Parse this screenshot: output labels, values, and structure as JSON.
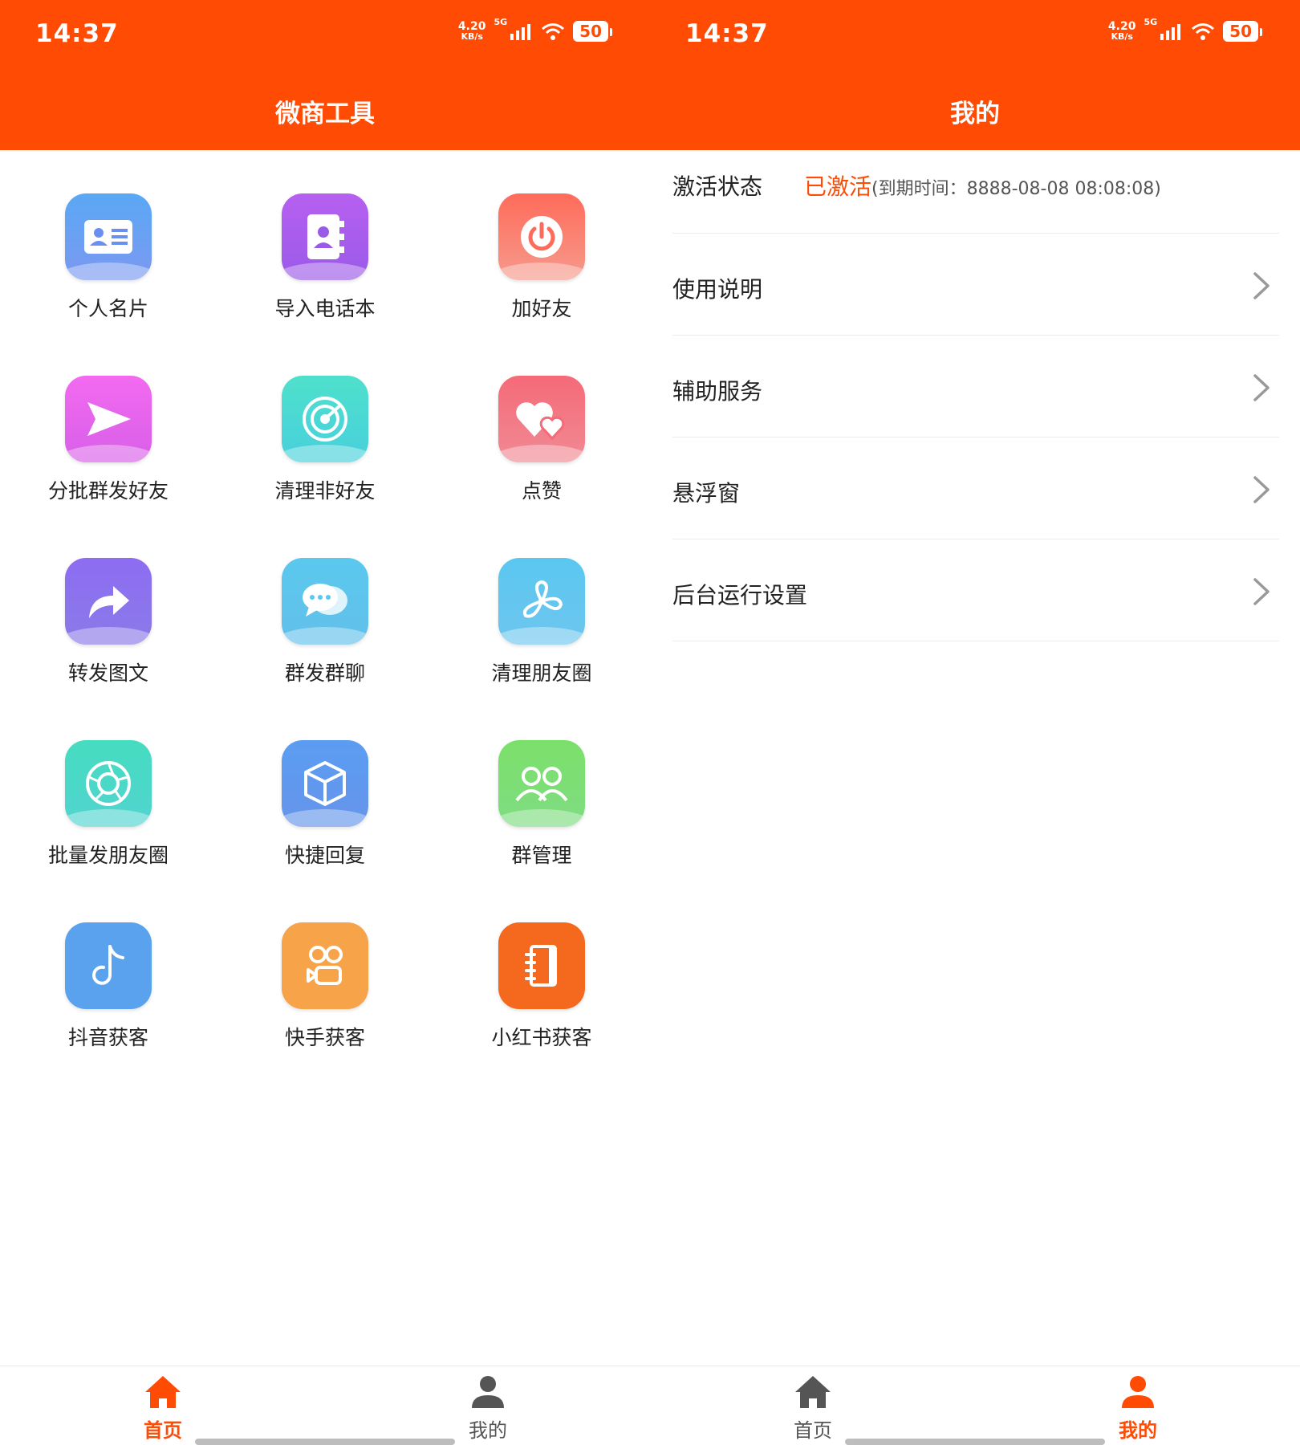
{
  "status": {
    "time": "14:37",
    "speed_value": "4.20",
    "speed_unit": "KB/s",
    "network": "5G",
    "battery": "50"
  },
  "home": {
    "title": "微商工具",
    "tools": [
      {
        "label": "个人名片",
        "icon": "id-card-icon",
        "colors": [
          "#5aa8f5",
          "#6b8ff0"
        ]
      },
      {
        "label": "导入电话本",
        "icon": "contact-book-icon",
        "colors": [
          "#b760f0",
          "#8b56e8"
        ]
      },
      {
        "label": "加好友",
        "icon": "power-icon",
        "colors": [
          "#ff6b5a",
          "#f38a7c"
        ]
      },
      {
        "label": "分批群发好友",
        "icon": "send-icon",
        "colors": [
          "#f26af0",
          "#d24fe6"
        ]
      },
      {
        "label": "清理非好友",
        "icon": "radar-icon",
        "colors": [
          "#4ee0cc",
          "#36c6d8"
        ]
      },
      {
        "label": "点赞",
        "icon": "hearts-icon",
        "colors": [
          "#f56a78",
          "#e9495a"
        ]
      },
      {
        "label": "转发图文",
        "icon": "share-arrow-icon",
        "colors": [
          "#8d6df2",
          "#6a5ae8"
        ]
      },
      {
        "label": "群发群聊",
        "icon": "chat-bubbles-icon",
        "colors": [
          "#5bc8ee",
          "#45b2e8"
        ]
      },
      {
        "label": "清理朋友圈",
        "icon": "pinwheel-icon",
        "colors": [
          "#5ac7f0",
          "#4fb4ec"
        ]
      },
      {
        "label": "批量发朋友圈",
        "icon": "aperture-icon",
        "colors": [
          "#45dcc0",
          "#3cc9c9"
        ]
      },
      {
        "label": "快捷回复",
        "icon": "cube-icon",
        "colors": [
          "#5a9df2",
          "#4d84e8"
        ]
      },
      {
        "label": "群管理",
        "icon": "group-icon",
        "colors": [
          "#7be06a",
          "#55cf5e"
        ]
      },
      {
        "label": "抖音获客",
        "icon": "music-note-icon",
        "colors": [
          "#5aa2ee",
          "#5aa2ee"
        ]
      },
      {
        "label": "快手获客",
        "icon": "video-camera-icon",
        "colors": [
          "#f6a34a",
          "#f6a34a"
        ]
      },
      {
        "label": "小红书获客",
        "icon": "notebook-icon",
        "colors": [
          "#f5691f",
          "#f5691f"
        ]
      }
    ]
  },
  "mine": {
    "title": "我的",
    "activation": {
      "label": "激活状态",
      "status": "已激活",
      "expire": "(到期时间：8888-08-08 08:08:08)"
    },
    "menu": [
      {
        "label": "使用说明"
      },
      {
        "label": "辅助服务"
      },
      {
        "label": "悬浮窗"
      },
      {
        "label": "后台运行设置"
      }
    ]
  },
  "nav": {
    "home": "首页",
    "mine": "我的"
  },
  "colors": {
    "brand": "#ff4b04",
    "inactive": "#555555"
  }
}
